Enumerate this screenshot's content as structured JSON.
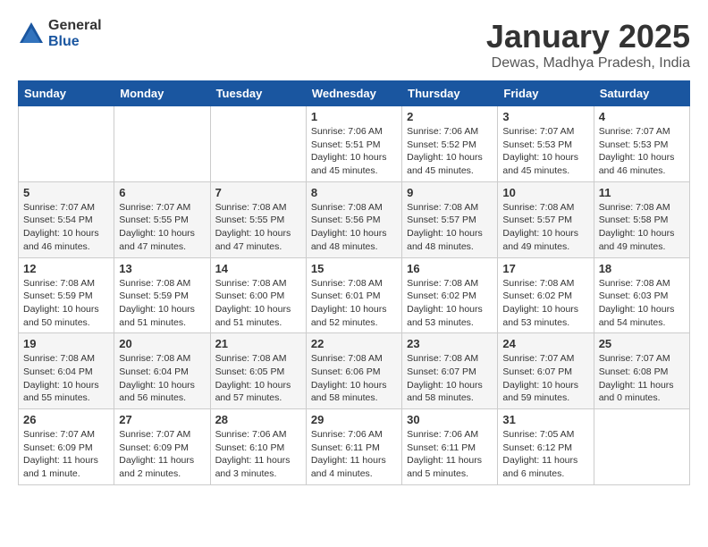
{
  "logo": {
    "general": "General",
    "blue": "Blue"
  },
  "title": "January 2025",
  "subtitle": "Dewas, Madhya Pradesh, India",
  "headers": [
    "Sunday",
    "Monday",
    "Tuesday",
    "Wednesday",
    "Thursday",
    "Friday",
    "Saturday"
  ],
  "weeks": [
    [
      {
        "day": "",
        "info": ""
      },
      {
        "day": "",
        "info": ""
      },
      {
        "day": "",
        "info": ""
      },
      {
        "day": "1",
        "info": "Sunrise: 7:06 AM\nSunset: 5:51 PM\nDaylight: 10 hours\nand 45 minutes."
      },
      {
        "day": "2",
        "info": "Sunrise: 7:06 AM\nSunset: 5:52 PM\nDaylight: 10 hours\nand 45 minutes."
      },
      {
        "day": "3",
        "info": "Sunrise: 7:07 AM\nSunset: 5:53 PM\nDaylight: 10 hours\nand 45 minutes."
      },
      {
        "day": "4",
        "info": "Sunrise: 7:07 AM\nSunset: 5:53 PM\nDaylight: 10 hours\nand 46 minutes."
      }
    ],
    [
      {
        "day": "5",
        "info": "Sunrise: 7:07 AM\nSunset: 5:54 PM\nDaylight: 10 hours\nand 46 minutes."
      },
      {
        "day": "6",
        "info": "Sunrise: 7:07 AM\nSunset: 5:55 PM\nDaylight: 10 hours\nand 47 minutes."
      },
      {
        "day": "7",
        "info": "Sunrise: 7:08 AM\nSunset: 5:55 PM\nDaylight: 10 hours\nand 47 minutes."
      },
      {
        "day": "8",
        "info": "Sunrise: 7:08 AM\nSunset: 5:56 PM\nDaylight: 10 hours\nand 48 minutes."
      },
      {
        "day": "9",
        "info": "Sunrise: 7:08 AM\nSunset: 5:57 PM\nDaylight: 10 hours\nand 48 minutes."
      },
      {
        "day": "10",
        "info": "Sunrise: 7:08 AM\nSunset: 5:57 PM\nDaylight: 10 hours\nand 49 minutes."
      },
      {
        "day": "11",
        "info": "Sunrise: 7:08 AM\nSunset: 5:58 PM\nDaylight: 10 hours\nand 49 minutes."
      }
    ],
    [
      {
        "day": "12",
        "info": "Sunrise: 7:08 AM\nSunset: 5:59 PM\nDaylight: 10 hours\nand 50 minutes."
      },
      {
        "day": "13",
        "info": "Sunrise: 7:08 AM\nSunset: 5:59 PM\nDaylight: 10 hours\nand 51 minutes."
      },
      {
        "day": "14",
        "info": "Sunrise: 7:08 AM\nSunset: 6:00 PM\nDaylight: 10 hours\nand 51 minutes."
      },
      {
        "day": "15",
        "info": "Sunrise: 7:08 AM\nSunset: 6:01 PM\nDaylight: 10 hours\nand 52 minutes."
      },
      {
        "day": "16",
        "info": "Sunrise: 7:08 AM\nSunset: 6:02 PM\nDaylight: 10 hours\nand 53 minutes."
      },
      {
        "day": "17",
        "info": "Sunrise: 7:08 AM\nSunset: 6:02 PM\nDaylight: 10 hours\nand 53 minutes."
      },
      {
        "day": "18",
        "info": "Sunrise: 7:08 AM\nSunset: 6:03 PM\nDaylight: 10 hours\nand 54 minutes."
      }
    ],
    [
      {
        "day": "19",
        "info": "Sunrise: 7:08 AM\nSunset: 6:04 PM\nDaylight: 10 hours\nand 55 minutes."
      },
      {
        "day": "20",
        "info": "Sunrise: 7:08 AM\nSunset: 6:04 PM\nDaylight: 10 hours\nand 56 minutes."
      },
      {
        "day": "21",
        "info": "Sunrise: 7:08 AM\nSunset: 6:05 PM\nDaylight: 10 hours\nand 57 minutes."
      },
      {
        "day": "22",
        "info": "Sunrise: 7:08 AM\nSunset: 6:06 PM\nDaylight: 10 hours\nand 58 minutes."
      },
      {
        "day": "23",
        "info": "Sunrise: 7:08 AM\nSunset: 6:07 PM\nDaylight: 10 hours\nand 58 minutes."
      },
      {
        "day": "24",
        "info": "Sunrise: 7:07 AM\nSunset: 6:07 PM\nDaylight: 10 hours\nand 59 minutes."
      },
      {
        "day": "25",
        "info": "Sunrise: 7:07 AM\nSunset: 6:08 PM\nDaylight: 11 hours\nand 0 minutes."
      }
    ],
    [
      {
        "day": "26",
        "info": "Sunrise: 7:07 AM\nSunset: 6:09 PM\nDaylight: 11 hours\nand 1 minute."
      },
      {
        "day": "27",
        "info": "Sunrise: 7:07 AM\nSunset: 6:09 PM\nDaylight: 11 hours\nand 2 minutes."
      },
      {
        "day": "28",
        "info": "Sunrise: 7:06 AM\nSunset: 6:10 PM\nDaylight: 11 hours\nand 3 minutes."
      },
      {
        "day": "29",
        "info": "Sunrise: 7:06 AM\nSunset: 6:11 PM\nDaylight: 11 hours\nand 4 minutes."
      },
      {
        "day": "30",
        "info": "Sunrise: 7:06 AM\nSunset: 6:11 PM\nDaylight: 11 hours\nand 5 minutes."
      },
      {
        "day": "31",
        "info": "Sunrise: 7:05 AM\nSunset: 6:12 PM\nDaylight: 11 hours\nand 6 minutes."
      },
      {
        "day": "",
        "info": ""
      }
    ]
  ]
}
